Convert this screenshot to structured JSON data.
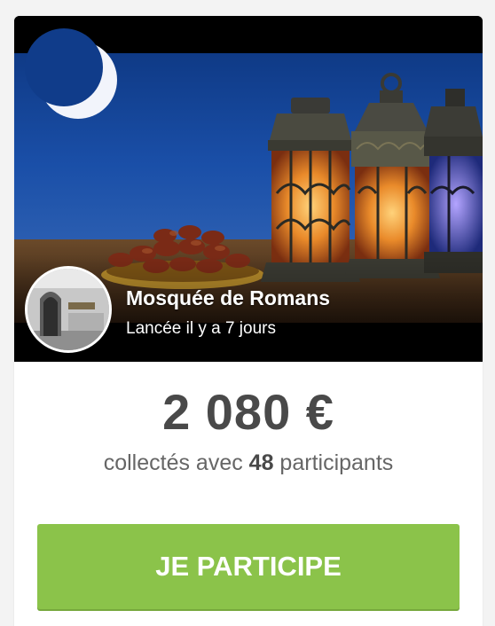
{
  "campaign": {
    "name": "Mosquée de Romans",
    "launched": "Lancée il y a 7 jours"
  },
  "stats": {
    "amount": "2 080 €",
    "collected_prefix": "collectés avec ",
    "participants_count": "48",
    "collected_suffix": " participants"
  },
  "actions": {
    "participate_label": "JE PARTICIPE"
  },
  "colors": {
    "button": "#8bc34a",
    "amount_text": "#494949",
    "secondary_text": "#666666",
    "sky": "#14449a"
  },
  "icons": {
    "hero": "ramadan-lanterns-image",
    "avatar": "mosque-avatar-image"
  }
}
